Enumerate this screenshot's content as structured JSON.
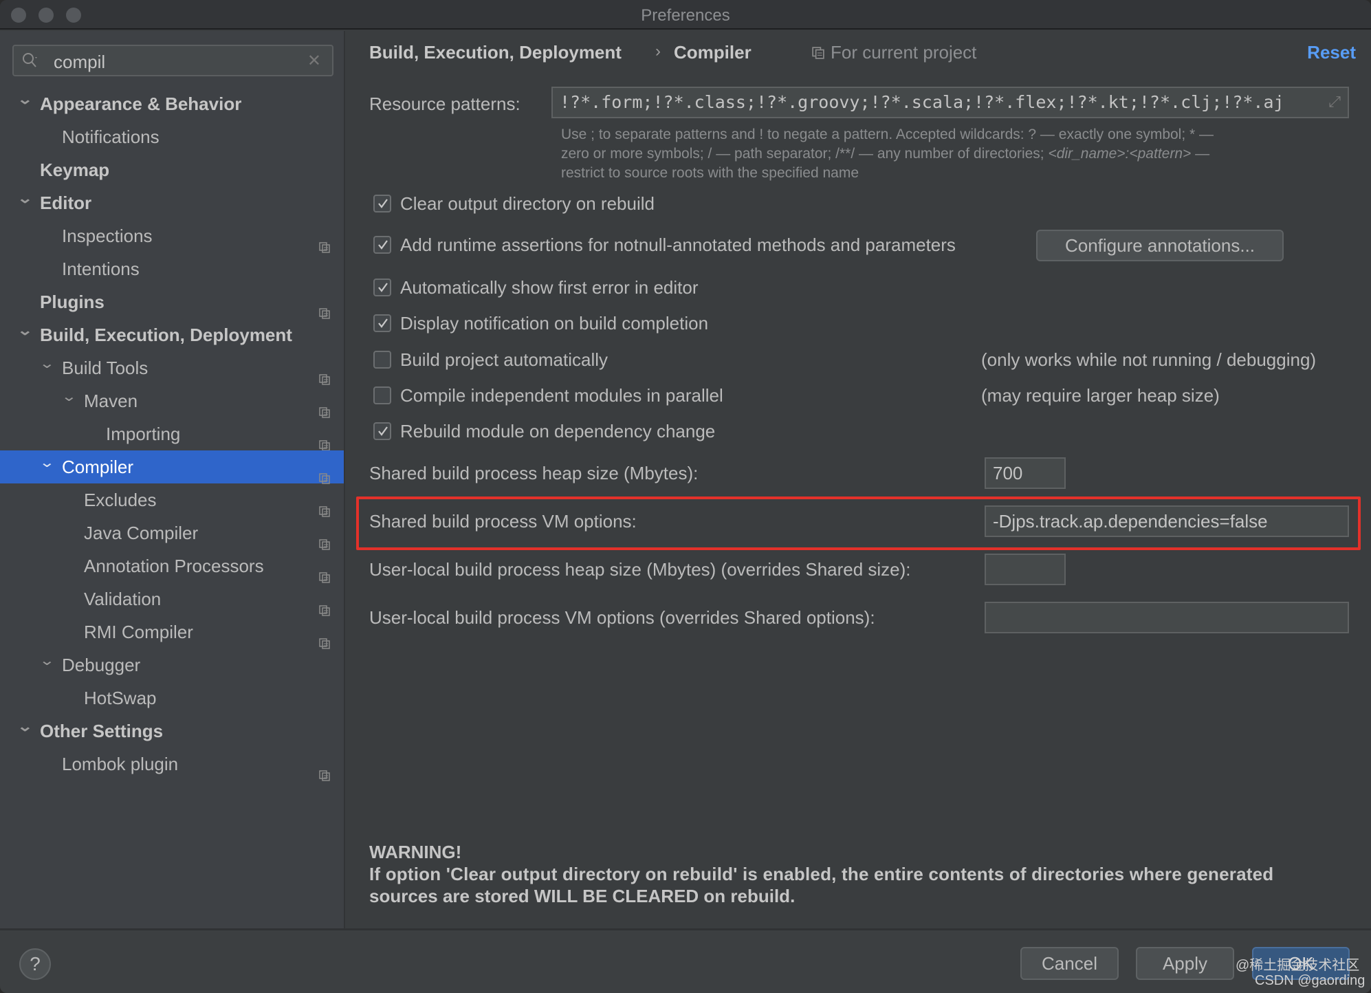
{
  "window": {
    "title": "Preferences"
  },
  "search": {
    "value": "compil",
    "clear_icon": "close-icon"
  },
  "tree": [
    {
      "label": "Appearance & Behavior",
      "level": 0,
      "chevron": true,
      "bold": true,
      "icon": false
    },
    {
      "label": "Notifications",
      "level": 1,
      "chevron": false,
      "bold": false,
      "icon": false
    },
    {
      "label": "Keymap",
      "level": 0,
      "chevron": false,
      "bold": true,
      "icon": false
    },
    {
      "label": "Editor",
      "level": 0,
      "chevron": true,
      "bold": true,
      "icon": false
    },
    {
      "label": "Inspections",
      "level": 1,
      "chevron": false,
      "bold": false,
      "icon": true
    },
    {
      "label": "Intentions",
      "level": 1,
      "chevron": false,
      "bold": false,
      "icon": false
    },
    {
      "label": "Plugins",
      "level": 0,
      "chevron": false,
      "bold": true,
      "icon": true
    },
    {
      "label": "Build, Execution, Deployment",
      "level": 0,
      "chevron": true,
      "bold": true,
      "icon": false
    },
    {
      "label": "Build Tools",
      "level": 1,
      "chevron": true,
      "bold": false,
      "icon": true
    },
    {
      "label": "Maven",
      "level": 2,
      "chevron": true,
      "bold": false,
      "icon": true
    },
    {
      "label": "Importing",
      "level": 3,
      "chevron": false,
      "bold": false,
      "icon": true
    },
    {
      "label": "Compiler",
      "level": 1,
      "chevron": true,
      "bold": false,
      "icon": true,
      "selected": true
    },
    {
      "label": "Excludes",
      "level": 2,
      "chevron": false,
      "bold": false,
      "icon": true
    },
    {
      "label": "Java Compiler",
      "level": 2,
      "chevron": false,
      "bold": false,
      "icon": true
    },
    {
      "label": "Annotation Processors",
      "level": 2,
      "chevron": false,
      "bold": false,
      "icon": true
    },
    {
      "label": "Validation",
      "level": 2,
      "chevron": false,
      "bold": false,
      "icon": true
    },
    {
      "label": "RMI Compiler",
      "level": 2,
      "chevron": false,
      "bold": false,
      "icon": true
    },
    {
      "label": "Debugger",
      "level": 1,
      "chevron": true,
      "bold": false,
      "icon": false
    },
    {
      "label": "HotSwap",
      "level": 2,
      "chevron": false,
      "bold": false,
      "icon": false
    },
    {
      "label": "Other Settings",
      "level": 0,
      "chevron": true,
      "bold": true,
      "icon": false
    },
    {
      "label": "Lombok plugin",
      "level": 1,
      "chevron": false,
      "bold": false,
      "icon": true
    }
  ],
  "header": {
    "breadcrumb_parent": "Build, Execution, Deployment",
    "breadcrumb_sep": "›",
    "breadcrumb_current": "Compiler",
    "scope": "For current project",
    "reset": "Reset"
  },
  "resource": {
    "label": "Resource patterns:",
    "value": "!?*.form;!?*.class;!?*.groovy;!?*.scala;!?*.flex;!?*.kt;!?*.clj;!?*.aj",
    "help_1": "Use ; to separate patterns and ! to negate a pattern. Accepted wildcards: ? — exactly one symbol; * —",
    "help_2a": "zero or more symbols; / — path separator; /**/ — any number of directories; ",
    "help_2b": "<dir_name>:<pattern>",
    "help_2c": " —",
    "help_3": "restrict to source roots with the specified name"
  },
  "options": [
    {
      "label": "Clear output directory on rebuild",
      "checked": true
    },
    {
      "label": "Add runtime assertions for notnull-annotated methods and parameters",
      "checked": true
    },
    {
      "label": "Automatically show first error in editor",
      "checked": true
    },
    {
      "label": "Display notification on build completion",
      "checked": true
    },
    {
      "label": "Build project automatically",
      "checked": false,
      "note": "(only works while not running / debugging)"
    },
    {
      "label": "Compile independent modules in parallel",
      "checked": false,
      "note": "(may require larger heap size)"
    },
    {
      "label": "Rebuild module on dependency change",
      "checked": true
    }
  ],
  "configure_annotations": "Configure annotations...",
  "heap": {
    "label": "Shared build process heap size (Mbytes):",
    "value": "700"
  },
  "vm": {
    "label": "Shared build process VM options:",
    "value": "-Djps.track.ap.dependencies=false",
    "highlight_color": "#e3312a"
  },
  "user_heap": {
    "label": "User-local build process heap size (Mbytes) (overrides Shared size):",
    "value": ""
  },
  "user_vm": {
    "label": "User-local build process VM options (overrides Shared options):",
    "value": ""
  },
  "warning": {
    "title": "WARNING!",
    "line1": "If option 'Clear output directory on rebuild' is enabled, the entire contents of directories where generated",
    "line2": "sources are stored WILL BE CLEARED on rebuild."
  },
  "footer": {
    "help": "?",
    "cancel": "Cancel",
    "apply": "Apply",
    "ok": "OK"
  },
  "watermark": {
    "line1": "@稀土掘金技术社区",
    "line2": "CSDN @gaording"
  },
  "colors": {
    "selection": "#2f65ca",
    "accent_link": "#589df6",
    "ok_button": "#365880"
  }
}
